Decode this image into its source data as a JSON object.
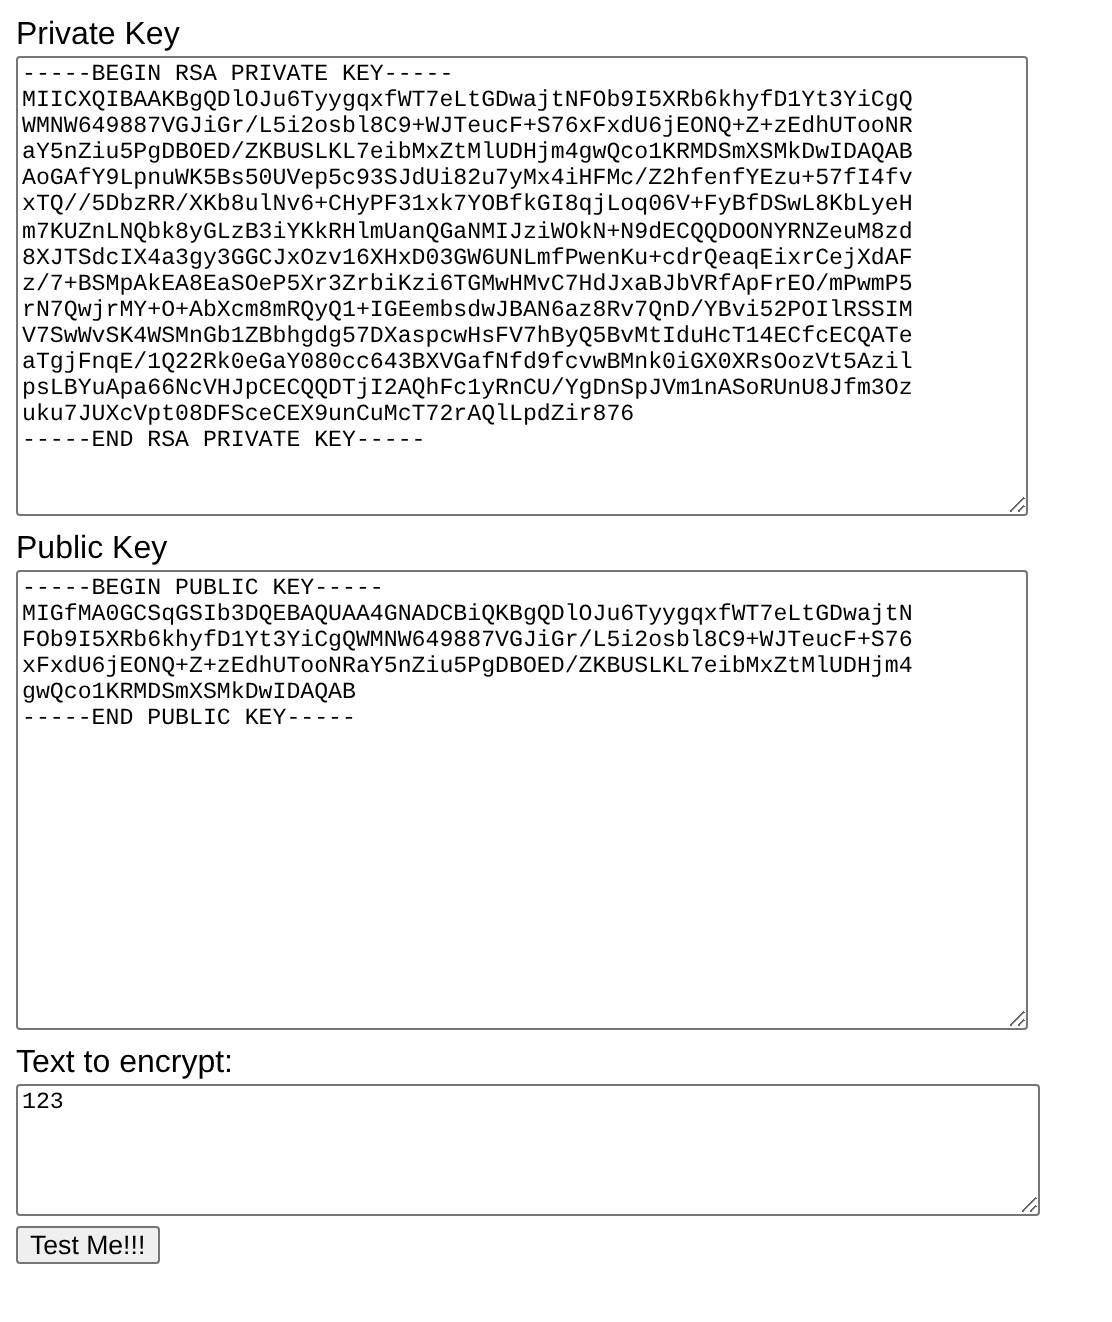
{
  "private_key": {
    "label": "Private Key",
    "lines": [
      "-----BEGIN RSA PRIVATE KEY-----",
      "MIICXQIBAAKBgQDlOJu6TyygqxfWT7eLtGDwajtNFOb9I5XRb6khyfD1Yt3YiCgQ",
      "WMNW649887VGJiGr/L5i2osbl8C9+WJTeucF+S76xFxdU6jEONQ+Z+zEdhUTooNR",
      "aY5nZiu5PgDBOED/ZKBUSLKL7eibMxZtMlUDHjm4gwQco1KRMDSmXSMkDwIDAQAB",
      "AoGAfY9LpnuWK5Bs50UVep5c93SJdUi82u7yMx4iHFMc/Z2hfenfYEzu+57fI4fv",
      "xTQ//5DbzRR/XKb8ulNv6+CHyPF31xk7YOBfkGI8qjLoq06V+FyBfDSwL8KbLyeH",
      "m7KUZnLNQbk8yGLzB3iYKkRHlmUanQGaNMIJziWOkN+N9dECQQDOONYRNZeuM8zd",
      "8XJTSdcIX4a3gy3GGCJxOzv16XHxD03GW6UNLmfPwenKu+cdrQeaqEixrCejXdAF",
      "z/7+BSMpAkEA8EaSOeP5Xr3ZrbiKzi6TGMwHMvC7HdJxaBJbVRfApFrEO/mPwmP5",
      "rN7QwjrMY+O+AbXcm8mRQyQ1+IGEembsdwJBAN6az8Rv7QnD/YBvi52POIlRSSIM",
      "V7SwWvSK4WSMnGb1ZBbhgdg57DXaspcwHsFV7hByQ5BvMtIduHcT14ECfcECQATe",
      "aTgjFnqE/1Q22Rk0eGaY080cc643BXVGafNfd9fcvwBMnk0iGX0XRsOozVt5Azil",
      "psLBYuApa66NcVHJpCECQQDTjI2AQhFc1yRnCU/YgDnSpJVm1nASoRUnU8Jfm3Oz",
      "uku7JUXcVpt08DFSceCEX9unCuMcT72rAQlLpdZir876",
      "-----END RSA PRIVATE KEY-----"
    ]
  },
  "public_key": {
    "label": "Public Key",
    "lines": [
      "-----BEGIN PUBLIC KEY-----",
      "MIGfMA0GCSqGSIb3DQEBAQUAA4GNADCBiQKBgQDlOJu6TyygqxfWT7eLtGDwajtN",
      "FOb9I5XRb6khyfD1Yt3YiCgQWMNW649887VGJiGr/L5i2osbl8C9+WJTeucF+S76",
      "xFxdU6jEONQ+Z+zEdhUTooNRaY5nZiu5PgDBOED/ZKBUSLKL7eibMxZtMlUDHjm4",
      "gwQco1KRMDSmXSMkDwIDAQAB",
      "-----END PUBLIC KEY-----"
    ]
  },
  "plaintext": {
    "label": "Text to encrypt:",
    "value": "123"
  },
  "button": {
    "label": "Test Me!!!"
  }
}
